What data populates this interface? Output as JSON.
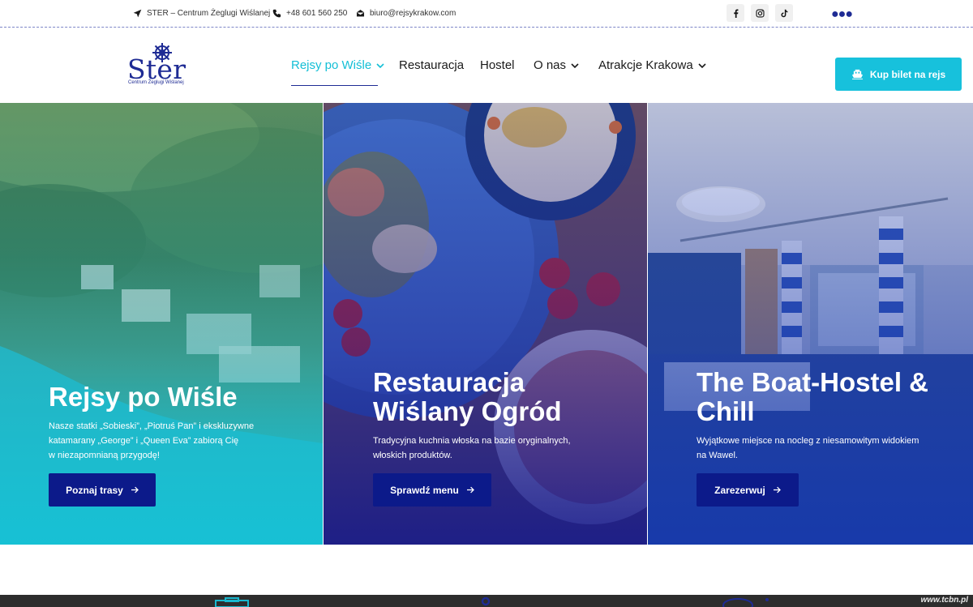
{
  "topbar": {
    "address": "STER – Centrum Żeglugi Wiślanej",
    "phone": "+48 601 560 250",
    "email": "biuro@rejsykrakow.com",
    "social": [
      "facebook-icon",
      "instagram-icon",
      "tiktok-icon"
    ]
  },
  "header": {
    "logo_text": "Ster",
    "logo_sub": "Centrum Żeglugi Wiślanej",
    "nav": [
      {
        "label": "Rejsy po Wiśle",
        "has_dropdown": true,
        "active": true
      },
      {
        "label": "Restauracja",
        "has_dropdown": false
      },
      {
        "label": "Hostel",
        "has_dropdown": false
      },
      {
        "label": "O nas",
        "has_dropdown": true
      },
      {
        "label": "Atrakcje Krakowa",
        "has_dropdown": true
      }
    ],
    "cta_label": "Kup bilet na rejs"
  },
  "panels": [
    {
      "title_line1": "Rejsy po Wiśle",
      "text_line1": "Nasze statki „Sobieski”, „Piotruś Pan” i ekskluzywne",
      "text_line2": "katamarany „George” i „Queen Eva” zabiorą Cię",
      "text_line3": "w niezapomnianą przygodę!",
      "button": "Poznaj trasy"
    },
    {
      "title_line1": "Restauracja",
      "title_line2": "Wiślany Ogród",
      "text_line1": "Tradycyjna kuchnia włoska na bazie oryginalnych,",
      "text_line2": "włoskich produktów.",
      "button": "Sprawdź menu"
    },
    {
      "title_line1": "The Boat-Hostel &",
      "title_line2": "Chill",
      "text_line1": "Wyjątkowe miejsce na nocleg z niesamowitym widokiem",
      "text_line2": "na Wawel.",
      "button": "Zarezerwuj"
    }
  ],
  "watermark": "www.tcbn.pl",
  "colors": {
    "accent": "#17c1dc",
    "navy": "#0c1a8a",
    "brand_blue": "#1e2b94"
  }
}
